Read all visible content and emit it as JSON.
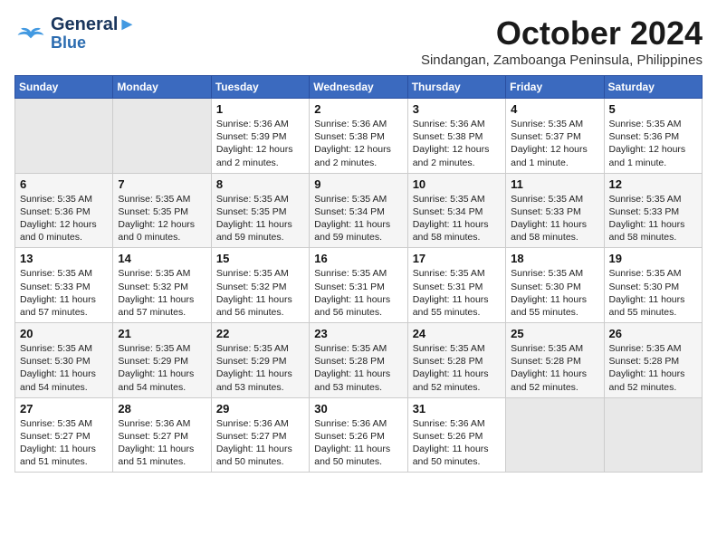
{
  "header": {
    "logo_line1": "General",
    "logo_line2": "Blue",
    "month": "October 2024",
    "location": "Sindangan, Zamboanga Peninsula, Philippines"
  },
  "days_of_week": [
    "Sunday",
    "Monday",
    "Tuesday",
    "Wednesday",
    "Thursday",
    "Friday",
    "Saturday"
  ],
  "weeks": [
    [
      {
        "day": "",
        "info": "",
        "empty": true
      },
      {
        "day": "",
        "info": "",
        "empty": true
      },
      {
        "day": "1",
        "info": "Sunrise: 5:36 AM\nSunset: 5:39 PM\nDaylight: 12 hours\nand 2 minutes."
      },
      {
        "day": "2",
        "info": "Sunrise: 5:36 AM\nSunset: 5:38 PM\nDaylight: 12 hours\nand 2 minutes."
      },
      {
        "day": "3",
        "info": "Sunrise: 5:36 AM\nSunset: 5:38 PM\nDaylight: 12 hours\nand 2 minutes."
      },
      {
        "day": "4",
        "info": "Sunrise: 5:35 AM\nSunset: 5:37 PM\nDaylight: 12 hours\nand 1 minute."
      },
      {
        "day": "5",
        "info": "Sunrise: 5:35 AM\nSunset: 5:36 PM\nDaylight: 12 hours\nand 1 minute."
      }
    ],
    [
      {
        "day": "6",
        "info": "Sunrise: 5:35 AM\nSunset: 5:36 PM\nDaylight: 12 hours\nand 0 minutes."
      },
      {
        "day": "7",
        "info": "Sunrise: 5:35 AM\nSunset: 5:35 PM\nDaylight: 12 hours\nand 0 minutes."
      },
      {
        "day": "8",
        "info": "Sunrise: 5:35 AM\nSunset: 5:35 PM\nDaylight: 11 hours\nand 59 minutes."
      },
      {
        "day": "9",
        "info": "Sunrise: 5:35 AM\nSunset: 5:34 PM\nDaylight: 11 hours\nand 59 minutes."
      },
      {
        "day": "10",
        "info": "Sunrise: 5:35 AM\nSunset: 5:34 PM\nDaylight: 11 hours\nand 58 minutes."
      },
      {
        "day": "11",
        "info": "Sunrise: 5:35 AM\nSunset: 5:33 PM\nDaylight: 11 hours\nand 58 minutes."
      },
      {
        "day": "12",
        "info": "Sunrise: 5:35 AM\nSunset: 5:33 PM\nDaylight: 11 hours\nand 58 minutes."
      }
    ],
    [
      {
        "day": "13",
        "info": "Sunrise: 5:35 AM\nSunset: 5:33 PM\nDaylight: 11 hours\nand 57 minutes."
      },
      {
        "day": "14",
        "info": "Sunrise: 5:35 AM\nSunset: 5:32 PM\nDaylight: 11 hours\nand 57 minutes."
      },
      {
        "day": "15",
        "info": "Sunrise: 5:35 AM\nSunset: 5:32 PM\nDaylight: 11 hours\nand 56 minutes."
      },
      {
        "day": "16",
        "info": "Sunrise: 5:35 AM\nSunset: 5:31 PM\nDaylight: 11 hours\nand 56 minutes."
      },
      {
        "day": "17",
        "info": "Sunrise: 5:35 AM\nSunset: 5:31 PM\nDaylight: 11 hours\nand 55 minutes."
      },
      {
        "day": "18",
        "info": "Sunrise: 5:35 AM\nSunset: 5:30 PM\nDaylight: 11 hours\nand 55 minutes."
      },
      {
        "day": "19",
        "info": "Sunrise: 5:35 AM\nSunset: 5:30 PM\nDaylight: 11 hours\nand 55 minutes."
      }
    ],
    [
      {
        "day": "20",
        "info": "Sunrise: 5:35 AM\nSunset: 5:30 PM\nDaylight: 11 hours\nand 54 minutes."
      },
      {
        "day": "21",
        "info": "Sunrise: 5:35 AM\nSunset: 5:29 PM\nDaylight: 11 hours\nand 54 minutes."
      },
      {
        "day": "22",
        "info": "Sunrise: 5:35 AM\nSunset: 5:29 PM\nDaylight: 11 hours\nand 53 minutes."
      },
      {
        "day": "23",
        "info": "Sunrise: 5:35 AM\nSunset: 5:28 PM\nDaylight: 11 hours\nand 53 minutes."
      },
      {
        "day": "24",
        "info": "Sunrise: 5:35 AM\nSunset: 5:28 PM\nDaylight: 11 hours\nand 52 minutes."
      },
      {
        "day": "25",
        "info": "Sunrise: 5:35 AM\nSunset: 5:28 PM\nDaylight: 11 hours\nand 52 minutes."
      },
      {
        "day": "26",
        "info": "Sunrise: 5:35 AM\nSunset: 5:28 PM\nDaylight: 11 hours\nand 52 minutes."
      }
    ],
    [
      {
        "day": "27",
        "info": "Sunrise: 5:35 AM\nSunset: 5:27 PM\nDaylight: 11 hours\nand 51 minutes."
      },
      {
        "day": "28",
        "info": "Sunrise: 5:36 AM\nSunset: 5:27 PM\nDaylight: 11 hours\nand 51 minutes."
      },
      {
        "day": "29",
        "info": "Sunrise: 5:36 AM\nSunset: 5:27 PM\nDaylight: 11 hours\nand 50 minutes."
      },
      {
        "day": "30",
        "info": "Sunrise: 5:36 AM\nSunset: 5:26 PM\nDaylight: 11 hours\nand 50 minutes."
      },
      {
        "day": "31",
        "info": "Sunrise: 5:36 AM\nSunset: 5:26 PM\nDaylight: 11 hours\nand 50 minutes."
      },
      {
        "day": "",
        "info": "",
        "empty": true
      },
      {
        "day": "",
        "info": "",
        "empty": true
      }
    ]
  ]
}
